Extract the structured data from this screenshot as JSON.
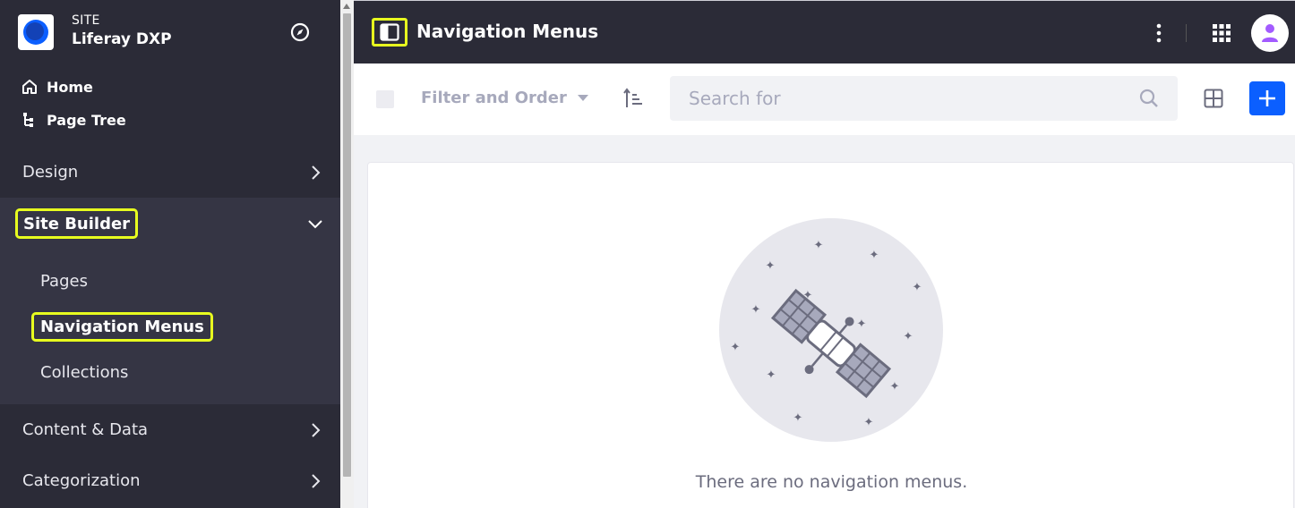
{
  "sidebar": {
    "site_label": "SITE",
    "site_name": "Liferay DXP",
    "links": [
      {
        "label": "Home",
        "icon": "home-icon"
      },
      {
        "label": "Page Tree",
        "icon": "page-tree-icon"
      }
    ],
    "sections": {
      "design": "Design",
      "site_builder": "Site Builder",
      "content_data": "Content & Data",
      "categorization": "Categorization"
    },
    "site_builder_items": [
      "Pages",
      "Navigation Menus",
      "Collections"
    ]
  },
  "header": {
    "title": "Navigation Menus"
  },
  "toolbar": {
    "filter_label": "Filter and Order",
    "search_placeholder": "Search for"
  },
  "empty_state": {
    "message": "There are no navigation menus."
  },
  "colors": {
    "sidebar_bg": "#2b2b37",
    "highlight": "#e8ff1f",
    "primary": "#0b5fff",
    "avatar_icon": "#a35bff"
  }
}
